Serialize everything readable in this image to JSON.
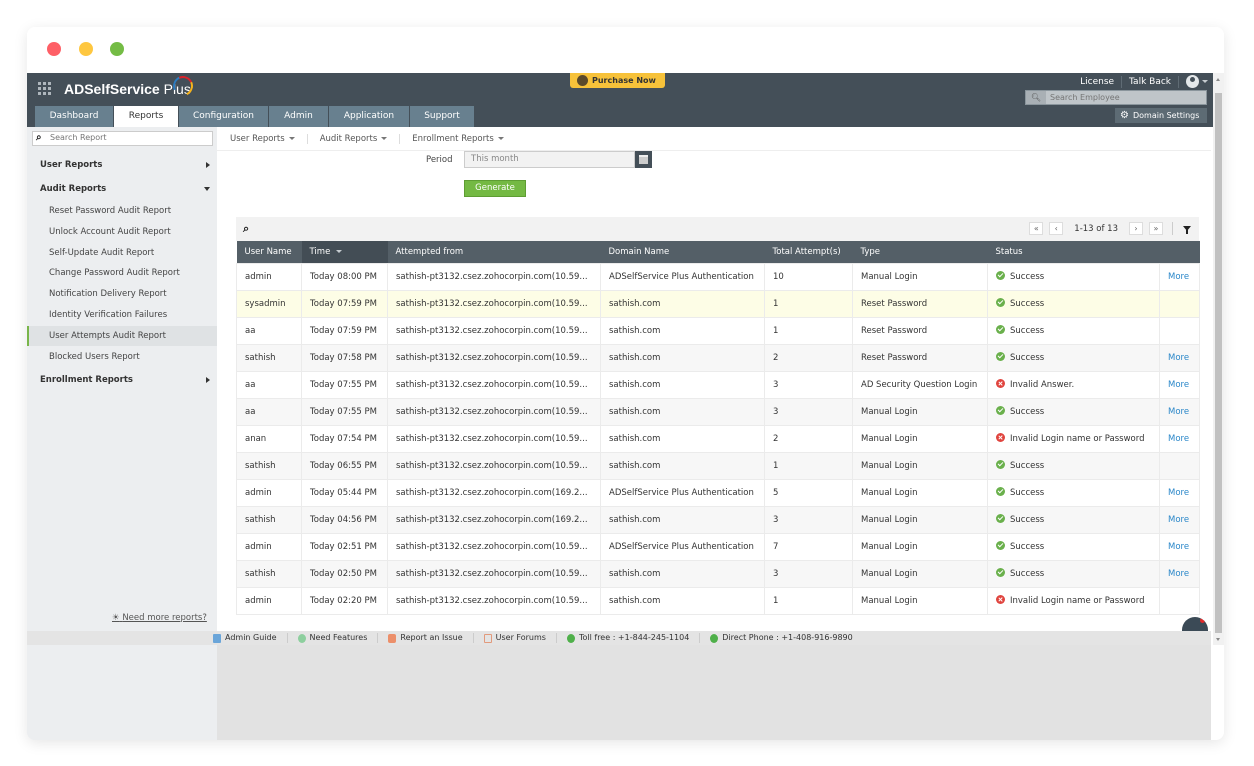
{
  "app": {
    "title_main": "ADSelfService",
    "title_plus": " Plus",
    "purchase_label": "Purchase Now",
    "license_label": "License",
    "talkback_label": "Talk Back",
    "employee_search_placeholder": "Search Employee",
    "domain_settings_label": "Domain Settings",
    "tabs": [
      {
        "label": "Dashboard",
        "active": false
      },
      {
        "label": "Reports",
        "active": true
      },
      {
        "label": "Configuration",
        "active": false
      },
      {
        "label": "Admin",
        "active": false
      },
      {
        "label": "Application",
        "active": false
      },
      {
        "label": "Support",
        "active": false
      }
    ]
  },
  "sidebar": {
    "search_placeholder": "Search Report",
    "groups": [
      {
        "label": "User Reports",
        "expanded": false
      },
      {
        "label": "Audit Reports",
        "expanded": true
      },
      {
        "label": "Enrollment Reports",
        "expanded": false
      }
    ],
    "audit_items": [
      "Reset Password Audit Report",
      "Unlock Account Audit Report",
      "Self-Update Audit Report",
      "Change Password Audit Report",
      "Notification Delivery Report",
      "Identity Verification Failures",
      "User Attempts Audit Report",
      "Blocked Users Report"
    ],
    "active_item": "User Attempts Audit Report",
    "need_more_label": "Need more reports?"
  },
  "subnav": [
    "User Reports",
    "Audit Reports",
    "Enrollment Reports"
  ],
  "filters": {
    "period_label": "Period",
    "period_value": "This month",
    "generate_label": "Generate"
  },
  "pager": {
    "info": "1-13 of 13",
    "first": "«",
    "prev": "‹",
    "next": "›",
    "last": "»"
  },
  "table": {
    "columns": [
      "User Name",
      "Time",
      "Attempted from",
      "Domain Name",
      "Total Attempt(s)",
      "Type",
      "Status",
      ""
    ],
    "sorted_column": "Time",
    "rows": [
      {
        "user": "admin",
        "time": "Today 08:00 PM",
        "from": "sathish-pt3132.csez.zohocorpin.com(10.59...",
        "domain": "ADSelfService Plus Authentication",
        "attempts": "10",
        "type": "Manual Login",
        "status": "Success",
        "ok": true,
        "more": "More"
      },
      {
        "user": "sysadmin",
        "time": "Today 07:59 PM",
        "from": "sathish-pt3132.csez.zohocorpin.com(10.59...",
        "domain": "sathish.com",
        "attempts": "1",
        "type": "Reset Password",
        "status": "Success",
        "ok": true,
        "more": ""
      },
      {
        "user": "aa",
        "time": "Today 07:59 PM",
        "from": "sathish-pt3132.csez.zohocorpin.com(10.59...",
        "domain": "sathish.com",
        "attempts": "1",
        "type": "Reset Password",
        "status": "Success",
        "ok": true,
        "more": ""
      },
      {
        "user": "sathish",
        "time": "Today 07:58 PM",
        "from": "sathish-pt3132.csez.zohocorpin.com(10.59...",
        "domain": "sathish.com",
        "attempts": "2",
        "type": "Reset Password",
        "status": "Success",
        "ok": true,
        "more": "More"
      },
      {
        "user": "aa",
        "time": "Today 07:55 PM",
        "from": "sathish-pt3132.csez.zohocorpin.com(10.59...",
        "domain": "sathish.com",
        "attempts": "3",
        "type": "AD Security Question Login",
        "status": "Invalid Answer.",
        "ok": false,
        "more": "More"
      },
      {
        "user": "aa",
        "time": "Today 07:55 PM",
        "from": "sathish-pt3132.csez.zohocorpin.com(10.59...",
        "domain": "sathish.com",
        "attempts": "3",
        "type": "Manual Login",
        "status": "Success",
        "ok": true,
        "more": "More"
      },
      {
        "user": "anan",
        "time": "Today 07:54 PM",
        "from": "sathish-pt3132.csez.zohocorpin.com(10.59...",
        "domain": "sathish.com",
        "attempts": "2",
        "type": "Manual Login",
        "status": "Invalid Login name or Password",
        "ok": false,
        "more": "More"
      },
      {
        "user": "sathish",
        "time": "Today 06:55 PM",
        "from": "sathish-pt3132.csez.zohocorpin.com(10.59...",
        "domain": "sathish.com",
        "attempts": "1",
        "type": "Manual Login",
        "status": "Success",
        "ok": true,
        "more": ""
      },
      {
        "user": "admin",
        "time": "Today 05:44 PM",
        "from": "sathish-pt3132.csez.zohocorpin.com(169.2...",
        "domain": "ADSelfService Plus Authentication",
        "attempts": "5",
        "type": "Manual Login",
        "status": "Success",
        "ok": true,
        "more": "More"
      },
      {
        "user": "sathish",
        "time": "Today 04:56 PM",
        "from": "sathish-pt3132.csez.zohocorpin.com(169.2...",
        "domain": "sathish.com",
        "attempts": "3",
        "type": "Manual Login",
        "status": "Success",
        "ok": true,
        "more": "More"
      },
      {
        "user": "admin",
        "time": "Today 02:51 PM",
        "from": "sathish-pt3132.csez.zohocorpin.com(10.59...",
        "domain": "ADSelfService Plus Authentication",
        "attempts": "7",
        "type": "Manual Login",
        "status": "Success",
        "ok": true,
        "more": "More"
      },
      {
        "user": "sathish",
        "time": "Today 02:50 PM",
        "from": "sathish-pt3132.csez.zohocorpin.com(10.59...",
        "domain": "sathish.com",
        "attempts": "3",
        "type": "Manual Login",
        "status": "Success",
        "ok": true,
        "more": "More"
      },
      {
        "user": "admin",
        "time": "Today 02:20 PM",
        "from": "sathish-pt3132.csez.zohocorpin.com(10.59...",
        "domain": "sathish.com",
        "attempts": "1",
        "type": "Manual Login",
        "status": "Invalid Login name or Password",
        "ok": false,
        "more": ""
      }
    ],
    "highlighted_row": 1
  },
  "footer": [
    {
      "label": "Admin Guide",
      "icon": "book"
    },
    {
      "label": "Need Features",
      "icon": "bulb"
    },
    {
      "label": "Report an Issue",
      "icon": "issue"
    },
    {
      "label": "User Forums",
      "icon": "forum"
    },
    {
      "label": "Toll free : +1-844-245-1104",
      "icon": "phone"
    },
    {
      "label": "Direct Phone : +1-408-916-9890",
      "icon": "phone"
    }
  ],
  "colors": {
    "accent_green": "#74b943",
    "header": "#444f58",
    "link": "#2a87c9",
    "success": "#6ab04c",
    "error": "#e0443e",
    "purchase": "#f7c23a"
  }
}
